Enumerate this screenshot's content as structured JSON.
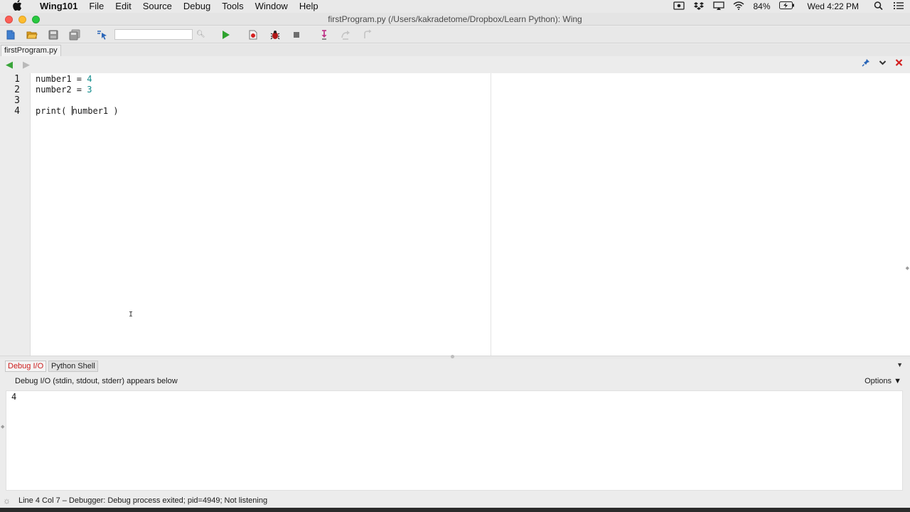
{
  "menubar": {
    "app": "Wing101",
    "items": [
      "File",
      "Edit",
      "Source",
      "Debug",
      "Tools",
      "Window",
      "Help"
    ],
    "battery": "84%",
    "clock": "Wed 4:22 PM"
  },
  "window": {
    "title": "firstProgram.py (/Users/kakradetome/Dropbox/Learn Python): Wing"
  },
  "toolbar": {
    "icons": [
      "new-file-icon",
      "open-folder-icon",
      "save-icon",
      "save-all-icon",
      "goto-definition-icon",
      "run-icon",
      "breakpoint-icon",
      "debug-bug-icon",
      "stop-icon",
      "step-into-icon",
      "step-over-icon",
      "step-out-icon"
    ],
    "search_value": ""
  },
  "editor": {
    "tab_label": "firstProgram.py",
    "lines": [
      {
        "number": "1",
        "text_a": "number1 = ",
        "num": "4",
        "text_b": ""
      },
      {
        "number": "2",
        "text_a": "number2 = ",
        "num": "3",
        "text_b": ""
      },
      {
        "number": "3",
        "text_a": "",
        "num": "",
        "text_b": ""
      },
      {
        "number": "4",
        "text_a": "print( ",
        "num": "",
        "text_b": "number1 )"
      }
    ]
  },
  "bottom_panel": {
    "tabs": [
      "Debug I/O",
      "Python Shell"
    ],
    "active_tab": "Debug I/O",
    "info": "Debug I/O (stdin, stdout, stderr) appears below",
    "options_label": "Options",
    "output": "4"
  },
  "status": {
    "text": "Line 4 Col 7 – Debugger: Debug process exited; pid=4949; Not listening"
  },
  "colors": {
    "run_green": "#2fa32f",
    "active_tab_red": "#cc1d1d",
    "number_teal": "#0e8a8a",
    "close_red": "#d21d1d"
  }
}
